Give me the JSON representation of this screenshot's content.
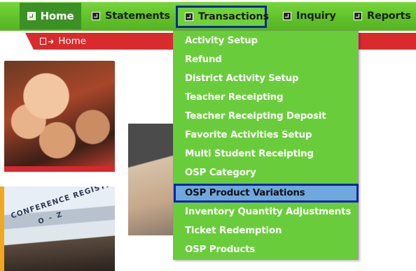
{
  "nav": {
    "items": [
      {
        "label": "Home",
        "icon": "arrow-box-icon",
        "active": true
      },
      {
        "label": "Statements",
        "icon": "arrow-box-icon"
      },
      {
        "label": "Transactions",
        "icon": "arrow-box-icon",
        "highlighted": true
      },
      {
        "label": "Inquiry",
        "icon": "arrow-box-icon"
      },
      {
        "label": "Reports",
        "icon": "arrow-box-icon"
      }
    ]
  },
  "breadcrumb": {
    "icon": "enter-arrow-icon",
    "label": "Home"
  },
  "photos": {
    "registration_sign": "CONFERENCE REGISTRATION",
    "registration_sub": "O - Z"
  },
  "dropdown": {
    "items": [
      {
        "label": "Activity Setup"
      },
      {
        "label": "Refund"
      },
      {
        "label": "District Activity Setup"
      },
      {
        "label": "Teacher Receipting"
      },
      {
        "label": "Teacher Receipting Deposit"
      },
      {
        "label": "Favorite Activities Setup"
      },
      {
        "label": "Multi Student Receipting"
      },
      {
        "label": "OSP Category"
      },
      {
        "label": "OSP Product Variations",
        "highlighted": true
      },
      {
        "label": "Inventory Quantity Adjustments"
      },
      {
        "label": "Ticket Redemption"
      },
      {
        "label": "OSP Products"
      }
    ]
  },
  "colors": {
    "nav_green": "#5fc129",
    "home_green": "#3c9124",
    "menu_green": "#69cd3b",
    "highlight_border": "#0b26a6",
    "highlight_fill": "#6fa8dc",
    "crumb_red": "#d92b2d"
  }
}
